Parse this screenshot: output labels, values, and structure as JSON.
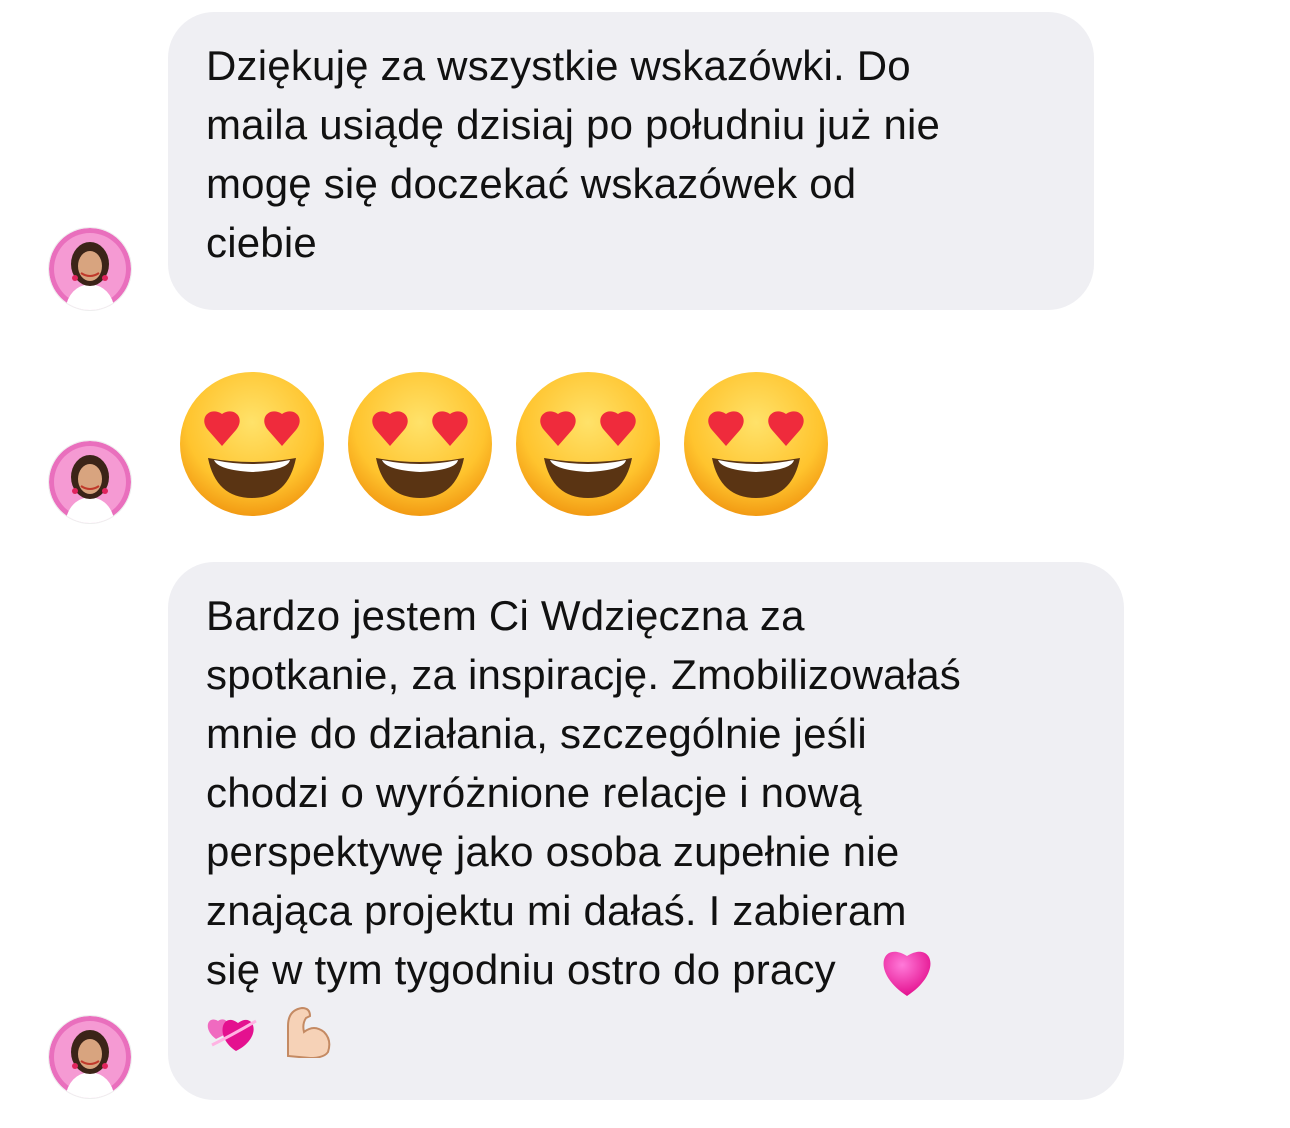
{
  "messages": [
    {
      "type": "text",
      "lines": [
        "Dziękuję za wszystkie wskazówki. Do",
        "maila usiądę dzisiaj po południu już nie",
        "mogę się doczekać wskazówek od",
        "ciebie"
      ]
    },
    {
      "type": "emoji",
      "emojis": [
        "heart-eyes-emoji",
        "heart-eyes-emoji",
        "heart-eyes-emoji",
        "heart-eyes-emoji"
      ]
    },
    {
      "type": "text",
      "lines": [
        "Bardzo jestem Ci Wdzięczna za",
        "spotkanie, za inspirację. Zmobilizowałaś",
        "mnie do działania, szczególnie jeśli",
        "chodzi o wyróżnione relacje i nową",
        "perspektywę jako osoba zupełnie nie",
        "znająca projektu mi dałaś. I zabieram",
        "się w tym tygodniu ostro do pracy"
      ],
      "trailing_emojis": [
        "pink-heart-emoji",
        "revolving-hearts-emoji",
        "flexed-biceps-emoji"
      ]
    }
  ],
  "colors": {
    "bubble": "#efeff3",
    "text": "#111111",
    "avatar_ring": "#e85fb1"
  }
}
